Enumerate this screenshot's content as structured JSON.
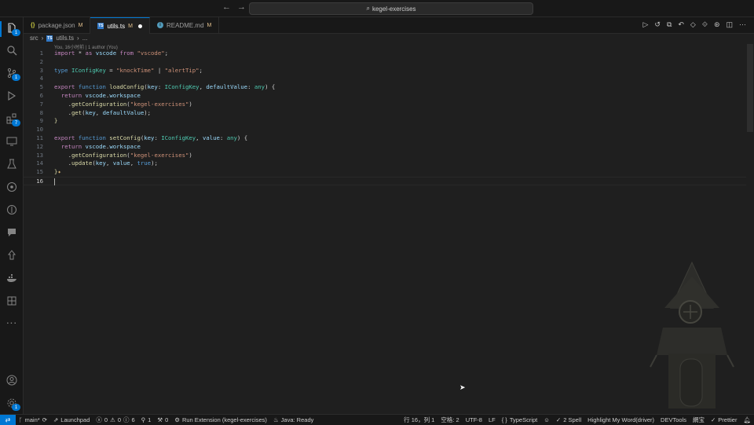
{
  "window": {
    "search_text": "kegel-exercises",
    "back_arrow": "←",
    "forward_arrow": "→"
  },
  "activity_bar": {
    "items": [
      {
        "icon": "explorer-icon",
        "badge": "1"
      },
      {
        "icon": "search-icon"
      },
      {
        "icon": "source-control-icon",
        "badge": "1"
      },
      {
        "icon": "run-debug-icon"
      },
      {
        "icon": "extensions-icon",
        "badge": "7"
      },
      {
        "icon": "remote-explorer-icon"
      },
      {
        "icon": "testing-icon"
      },
      {
        "icon": "gitlens-icon"
      },
      {
        "icon": "timeline-icon"
      },
      {
        "icon": "chat-icon"
      },
      {
        "icon": "deploy-icon"
      },
      {
        "icon": "docker-icon"
      },
      {
        "icon": "grid-icon"
      },
      {
        "icon": "more-icon",
        "glyph": "···"
      }
    ],
    "bottom": [
      {
        "icon": "account-icon"
      },
      {
        "icon": "manage-gear-icon",
        "badge": "1"
      }
    ]
  },
  "tabs": [
    {
      "name": "package.json",
      "status": "M",
      "type": "json"
    },
    {
      "name": "utils.ts",
      "status": "M",
      "type": "ts",
      "active": true,
      "dirty": true
    },
    {
      "name": "README.md",
      "status": "M",
      "type": "md"
    }
  ],
  "breadcrumb": {
    "folder": "src",
    "file": "utils.ts",
    "symbol": "..."
  },
  "codelens": "You, 16小时前 | 1 author (You)",
  "code_lines": [
    {
      "n": "1"
    },
    {
      "n": "2"
    },
    {
      "n": "3"
    },
    {
      "n": "4"
    },
    {
      "n": "5"
    },
    {
      "n": "6"
    },
    {
      "n": "7"
    },
    {
      "n": "8"
    },
    {
      "n": "9"
    },
    {
      "n": "10"
    },
    {
      "n": "11"
    },
    {
      "n": "12"
    },
    {
      "n": "13"
    },
    {
      "n": "14"
    },
    {
      "n": "15"
    },
    {
      "n": "16"
    }
  ],
  "code": {
    "l1": {
      "import": "import",
      "star": " * ",
      "as": "as",
      "vscode": " vscode ",
      "from": "from",
      "str": " \"vscode\"",
      "semi": ";"
    },
    "l3": {
      "type": "type",
      "name": " IConfigKey",
      "eq": " = ",
      "s1": "\"knockTime\"",
      "bar": " | ",
      "s2": "\"alertTip\"",
      "semi": ";"
    },
    "l5": {
      "export": "export",
      "function": " function ",
      "fname": "loadConfig",
      "p1": "(",
      "key": "key",
      "c1": ": ",
      "t1": "IConfigKey",
      "comma": ", ",
      "dv": "defaultValue",
      "c2": ": ",
      "any": "any",
      "close": ") {"
    },
    "l6": {
      "return": "return",
      "vscode": " vscode",
      "dot": ".",
      "ws": "workspace"
    },
    "l7": {
      "dot": ".",
      "fn": "getConfiguration",
      "p": "(",
      "str": "\"kegel-exercises\"",
      "cp": ")"
    },
    "l8": {
      "dot": ".",
      "fn": "get",
      "p": "(",
      "key": "key",
      "comma": ", ",
      "dv": "defaultValue",
      "cp": ");"
    },
    "l9": {
      "brace": "}"
    },
    "l11": {
      "export": "export",
      "function": " function ",
      "fname": "setConfig",
      "p1": "(",
      "key": "key",
      "c1": ": ",
      "t1": "IConfigKey",
      "comma": ", ",
      "val": "value",
      "c2": ": ",
      "any": "any",
      "close": ") {"
    },
    "l12": {
      "return": "return",
      "vscode": " vscode",
      "dot": ".",
      "ws": "workspace"
    },
    "l13": {
      "dot": ".",
      "fn": "getConfiguration",
      "p": "(",
      "str": "\"kegel-exercises\"",
      "cp": ")"
    },
    "l14": {
      "dot": ".",
      "fn": "update",
      "p": "(",
      "key": "key",
      "comma": ", ",
      "val": "value",
      "comma2": ", ",
      "tru": "true",
      "cp": ");"
    },
    "l15": {
      "brace": "}",
      "sparkle": "✦"
    }
  },
  "status_bar": {
    "remote": "⇄",
    "branch": "main*",
    "launchpad": "Launchpad",
    "errors": "0",
    "warnings": "0",
    "info": "6",
    "ports": "1",
    "tasks": "0",
    "run_extension": "Run Extension (kegel-exercises)",
    "java": "Java: Ready",
    "position": "行 16，列 1",
    "spaces": "空格: 2",
    "encoding": "UTF-8",
    "eol": "LF",
    "braces": "{ }",
    "language": "TypeScript",
    "spell": "2 Spell",
    "highlight": "Highlight My Word(driver)",
    "devtools": "DEVTools",
    "other": "網宝",
    "prettier": "Prettier"
  },
  "colors": {
    "accent": "#0078d4",
    "keyword": "#c586c0",
    "storage": "#569cd6",
    "function": "#dcdcaa",
    "type": "#4ec9b0",
    "string": "#ce9178",
    "variable": "#9cdcfe"
  }
}
